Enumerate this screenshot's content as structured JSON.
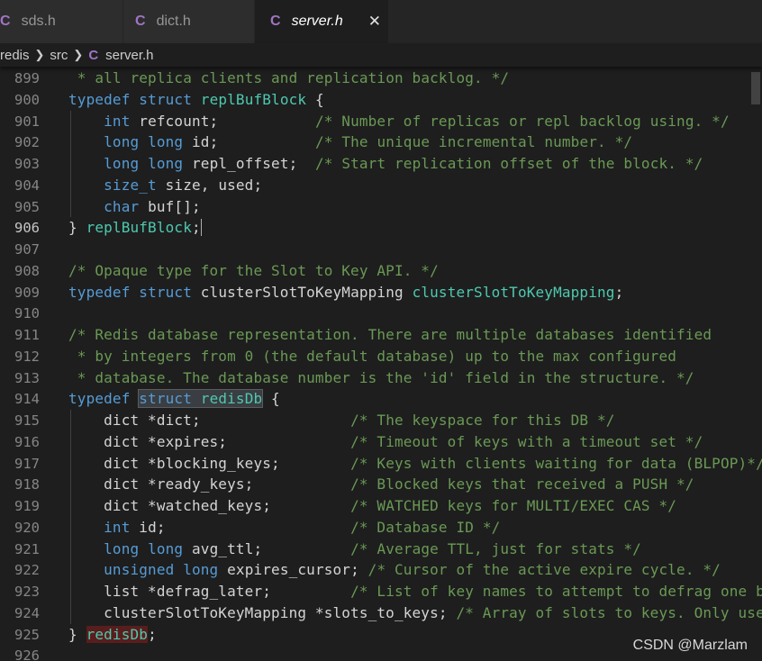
{
  "tabs": [
    {
      "icon": "C",
      "label": "sds.h",
      "active": false
    },
    {
      "icon": "C",
      "label": "dict.h",
      "active": false
    },
    {
      "icon": "C",
      "label": "server.h",
      "active": true,
      "close": "✕"
    }
  ],
  "breadcrumb": {
    "parts": [
      "redis",
      "src"
    ],
    "file_icon": "C",
    "file": "server.h"
  },
  "colors": {
    "keyword": "#569cd6",
    "type": "#4ec9b0",
    "comment": "#6a9955",
    "text": "#d4d4d4",
    "icon": "#a074c4"
  },
  "lines": [
    {
      "n": "899",
      "html": " <span class=\"cm\">* all replica clients and replication backlog. */</span>"
    },
    {
      "n": "900",
      "html": "<span class=\"kw\">typedef</span> <span class=\"kw\">struct</span> <span class=\"ty\">replBufBlock</span> {"
    },
    {
      "n": "901",
      "html": "    <span class=\"kw\">int</span> refcount;           <span class=\"cm\">/* Number of replicas or repl backlog using. */</span>"
    },
    {
      "n": "902",
      "html": "    <span class=\"kw\">long</span> <span class=\"kw\">long</span> id;           <span class=\"cm\">/* The unique incremental number. */</span>"
    },
    {
      "n": "903",
      "html": "    <span class=\"kw\">long</span> <span class=\"kw\">long</span> repl_offset;  <span class=\"cm\">/* Start replication offset of the block. */</span>"
    },
    {
      "n": "904",
      "html": "    <span class=\"kw\">size_t</span> size, used;"
    },
    {
      "n": "905",
      "html": "    <span class=\"kw\">char</span> buf[];"
    },
    {
      "n": "906",
      "html": "} <span class=\"ty\">replBufBlock</span>;<span style=\"border-left:1px solid #aeafad\"></span>",
      "current": true
    },
    {
      "n": "907",
      "html": ""
    },
    {
      "n": "908",
      "html": "<span class=\"cm\">/* Opaque type for the Slot to Key API. */</span>"
    },
    {
      "n": "909",
      "html": "<span class=\"kw\">typedef</span> <span class=\"kw\">struct</span> clusterSlotToKeyMapping <span class=\"ty\">clusterSlotToKeyMapping</span>;"
    },
    {
      "n": "910",
      "html": ""
    },
    {
      "n": "911",
      "html": "<span class=\"cm\">/* Redis database representation. There are multiple databases identified</span>"
    },
    {
      "n": "912",
      "html": "<span class=\"cm\"> * by integers from 0 (the default database) up to the max configured</span>"
    },
    {
      "n": "913",
      "html": "<span class=\"cm\"> * database. The database number is the 'id' field in the structure. */</span>"
    },
    {
      "n": "914",
      "html": "<span class=\"kw\">typedef</span> <span class=\"hl-sel\"><span class=\"kw\">struct</span> <span class=\"ty\">redisDb</span></span> {"
    },
    {
      "n": "915",
      "html": "    dict *dict;                 <span class=\"cm\">/* The keyspace for this DB */</span>"
    },
    {
      "n": "916",
      "html": "    dict *expires;              <span class=\"cm\">/* Timeout of keys with a timeout set */</span>"
    },
    {
      "n": "917",
      "html": "    dict *blocking_keys;        <span class=\"cm\">/* Keys with clients waiting for data (BLPOP)*/</span>"
    },
    {
      "n": "918",
      "html": "    dict *ready_keys;           <span class=\"cm\">/* Blocked keys that received a PUSH */</span>"
    },
    {
      "n": "919",
      "html": "    dict *watched_keys;         <span class=\"cm\">/* WATCHED keys for MULTI/EXEC CAS */</span>"
    },
    {
      "n": "920",
      "html": "    <span class=\"kw\">int</span> id;                     <span class=\"cm\">/* Database ID */</span>"
    },
    {
      "n": "921",
      "html": "    <span class=\"kw\">long</span> <span class=\"kw\">long</span> avg_ttl;          <span class=\"cm\">/* Average TTL, just for stats */</span>"
    },
    {
      "n": "922",
      "html": "    <span class=\"kw\">unsigned</span> <span class=\"kw\">long</span> expires_cursor; <span class=\"cm\">/* Cursor of the active expire cycle. */</span>"
    },
    {
      "n": "923",
      "html": "    list *defrag_later;         <span class=\"cm\">/* List of key names to attempt to defrag one by</span>"
    },
    {
      "n": "924",
      "html": "    clusterSlotToKeyMapping *slots_to_keys; <span class=\"cm\">/* Array of slots to keys. Only used</span>"
    },
    {
      "n": "925",
      "html": "} <span class=\"bracket-hl\"><span class=\"ty\">redisDb</span></span>;"
    },
    {
      "n": "926",
      "html": ""
    }
  ],
  "watermark": "CSDN @Marzlam"
}
